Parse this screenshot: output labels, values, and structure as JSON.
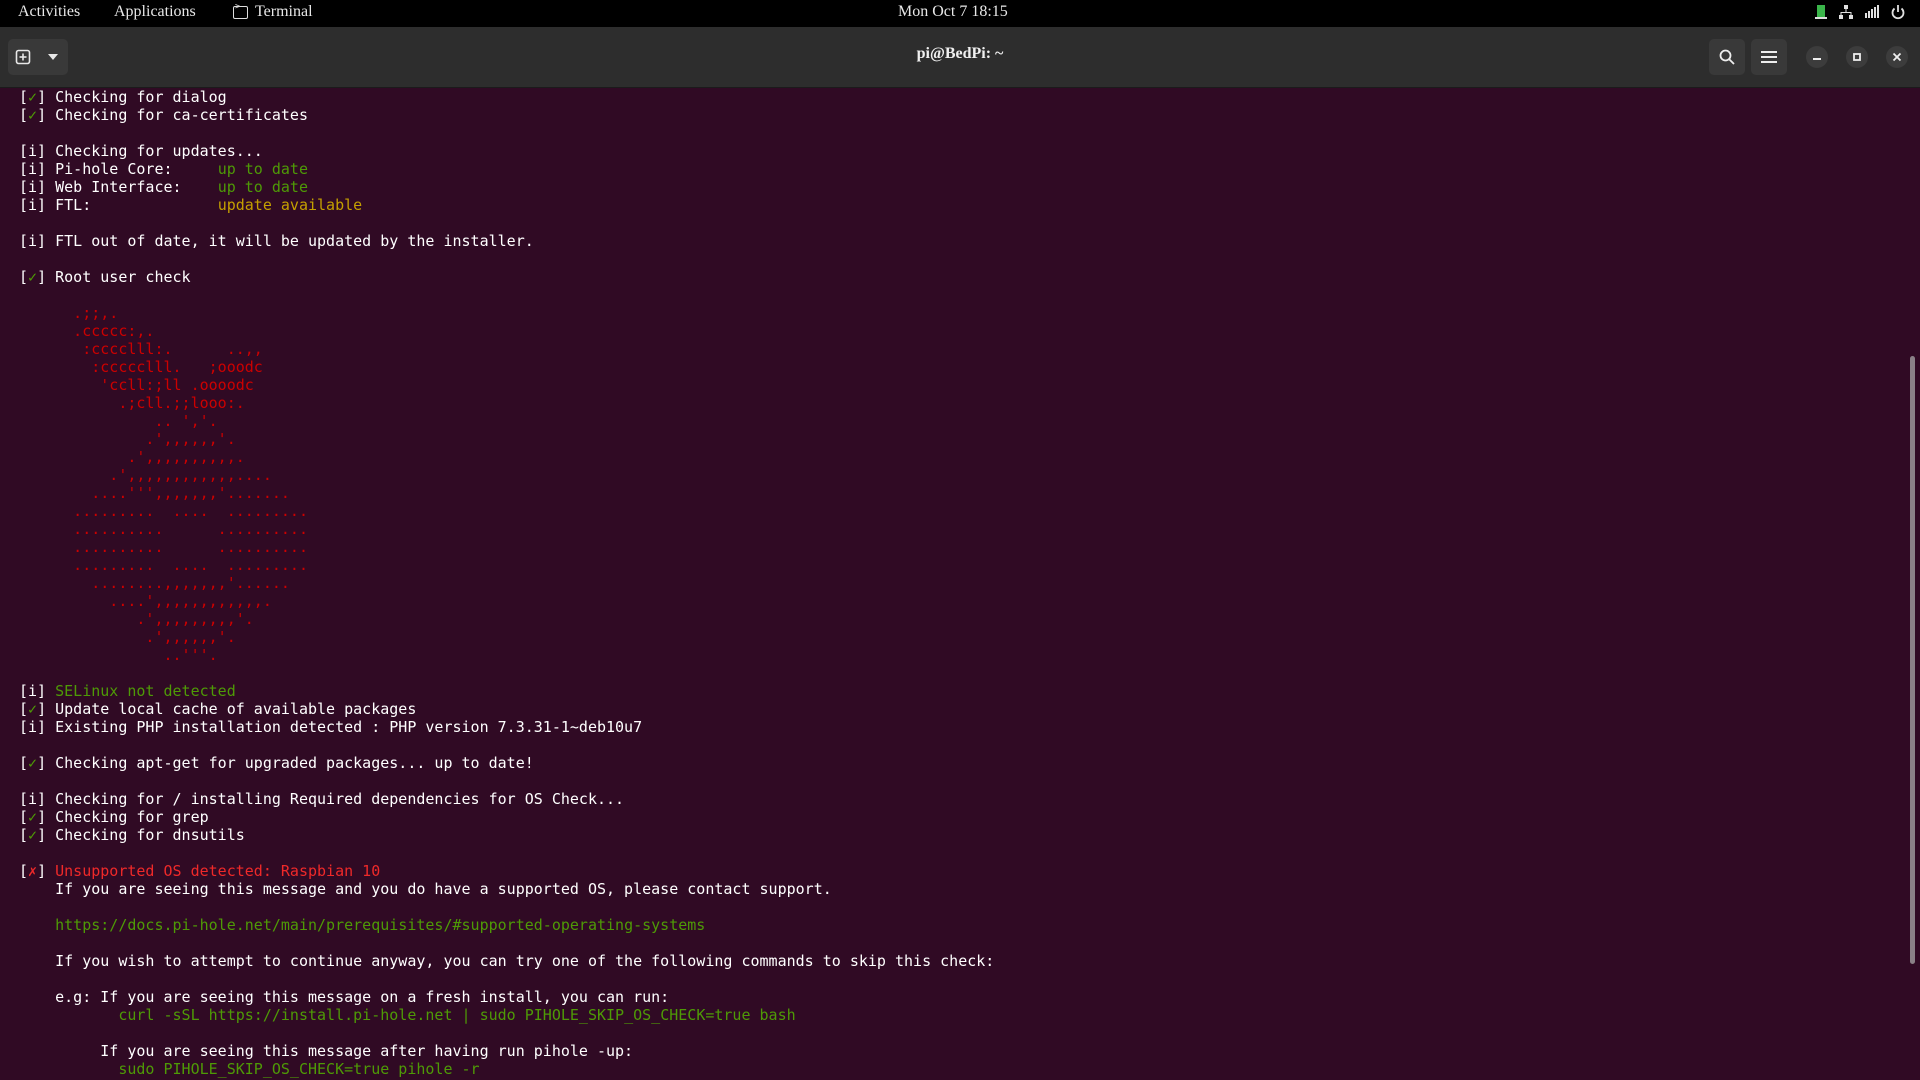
{
  "topbar": {
    "activities": "Activities",
    "applications": "Applications",
    "app_name": "Terminal",
    "clock": "Mon  Oct  7  18:15",
    "tray_icons": [
      "monitor-icon",
      "network-icon",
      "volume-icon",
      "power-icon"
    ]
  },
  "window": {
    "title": "pi@BedPi: ~",
    "buttons": [
      "new-tab",
      "tab-menu",
      "search",
      "hamburger-menu",
      "minimize",
      "maximize",
      "close"
    ]
  },
  "terminal": {
    "lines": [
      [
        {
          "t": "[",
          "c": ""
        },
        {
          "t": "✓",
          "c": "ok"
        },
        {
          "t": "] Checking for dialog",
          "c": ""
        }
      ],
      [
        {
          "t": "[",
          "c": ""
        },
        {
          "t": "✓",
          "c": "ok"
        },
        {
          "t": "] Checking for ca-certificates",
          "c": ""
        }
      ],
      [],
      [
        {
          "t": "[i] Checking for updates...",
          "c": ""
        }
      ],
      [
        {
          "t": "[i] Pi-hole Core:     ",
          "c": ""
        },
        {
          "t": "up to date",
          "c": "green"
        }
      ],
      [
        {
          "t": "[i] Web Interface:    ",
          "c": ""
        },
        {
          "t": "up to date",
          "c": "green"
        }
      ],
      [
        {
          "t": "[i] FTL:              ",
          "c": ""
        },
        {
          "t": "update available",
          "c": "yellow"
        }
      ],
      [],
      [
        {
          "t": "[i] FTL out of date, it will be updated by the installer.",
          "c": ""
        }
      ],
      [],
      [
        {
          "t": "[",
          "c": ""
        },
        {
          "t": "✓",
          "c": "ok"
        },
        {
          "t": "] Root user check",
          "c": ""
        }
      ],
      [],
      [
        {
          "t": "      .;;,.",
          "c": "art"
        }
      ],
      [
        {
          "t": "      .ccccc:,.",
          "c": "art"
        }
      ],
      [
        {
          "t": "       :cccclll:.      ..,,",
          "c": "art"
        }
      ],
      [
        {
          "t": "        :ccccclll.   ;ooodc",
          "c": "art"
        }
      ],
      [
        {
          "t": "         'ccll:;ll .oooodc",
          "c": "art"
        }
      ],
      [
        {
          "t": "           .;cll.;;looo:.",
          "c": "art"
        }
      ],
      [
        {
          "t": "               .. ','.",
          "c": "art"
        }
      ],
      [
        {
          "t": "              .',,,,,,'.",
          "c": "art"
        }
      ],
      [
        {
          "t": "            .',,,,,,,,,,.",
          "c": "art"
        }
      ],
      [
        {
          "t": "          .',,,,,,,,,,,,....",
          "c": "art"
        }
      ],
      [
        {
          "t": "        ....''',,,,,,,'.......",
          "c": "art"
        }
      ],
      [
        {
          "t": "      .........  ....  .........",
          "c": "art"
        }
      ],
      [
        {
          "t": "      ..........      ..........",
          "c": "art"
        }
      ],
      [
        {
          "t": "      ..........      ..........",
          "c": "art"
        }
      ],
      [
        {
          "t": "      .........  ....  .........",
          "c": "art"
        }
      ],
      [
        {
          "t": "        ........,,,,,,,'......",
          "c": "art"
        }
      ],
      [
        {
          "t": "          ....',,,,,,,,,,,,.",
          "c": "art"
        }
      ],
      [
        {
          "t": "             .',,,,,,,,,'.",
          "c": "art"
        }
      ],
      [
        {
          "t": "              .',,,,,,'.",
          "c": "art"
        }
      ],
      [
        {
          "t": "                ..'''.",
          "c": "art"
        }
      ],
      [],
      [
        {
          "t": "[i] ",
          "c": ""
        },
        {
          "t": "SELinux not detected",
          "c": "green"
        }
      ],
      [
        {
          "t": "[",
          "c": ""
        },
        {
          "t": "✓",
          "c": "ok"
        },
        {
          "t": "] Update local cache of available packages",
          "c": ""
        }
      ],
      [
        {
          "t": "[i] Existing PHP installation detected : PHP version 7.3.31-1~deb10u7",
          "c": ""
        }
      ],
      [],
      [
        {
          "t": "[",
          "c": ""
        },
        {
          "t": "✓",
          "c": "ok"
        },
        {
          "t": "] Checking apt-get for upgraded packages... up to date!",
          "c": ""
        }
      ],
      [],
      [
        {
          "t": "[i] Checking for / installing Required dependencies for OS Check...",
          "c": ""
        }
      ],
      [
        {
          "t": "[",
          "c": ""
        },
        {
          "t": "✓",
          "c": "ok"
        },
        {
          "t": "] Checking for grep",
          "c": ""
        }
      ],
      [
        {
          "t": "[",
          "c": ""
        },
        {
          "t": "✓",
          "c": "ok"
        },
        {
          "t": "] Checking for dnsutils",
          "c": ""
        }
      ],
      [],
      [
        {
          "t": "[",
          "c": ""
        },
        {
          "t": "✗",
          "c": "err"
        },
        {
          "t": "] ",
          "c": ""
        },
        {
          "t": "Unsupported OS detected: Raspbian 10",
          "c": "err"
        }
      ],
      [
        {
          "t": "    If you are seeing this message and you do have a supported OS, please contact support.",
          "c": ""
        }
      ],
      [],
      [
        {
          "t": "    ",
          "c": ""
        },
        {
          "t": "https://docs.pi-hole.net/main/prerequisites/#supported-operating-systems",
          "c": "green"
        }
      ],
      [],
      [
        {
          "t": "    If you wish to attempt to continue anyway, you can try one of the following commands to skip this check:",
          "c": ""
        }
      ],
      [],
      [
        {
          "t": "    e.g: If you are seeing this message on a fresh install, you can run:",
          "c": ""
        }
      ],
      [
        {
          "t": "           ",
          "c": ""
        },
        {
          "t": "curl -sSL https://install.pi-hole.net | sudo PIHOLE_SKIP_OS_CHECK=true bash",
          "c": "green"
        }
      ],
      [],
      [
        {
          "t": "         If you are seeing this message after having run pihole -up:",
          "c": ""
        }
      ],
      [
        {
          "t": "           ",
          "c": ""
        },
        {
          "t": "sudo PIHOLE_SKIP_OS_CHECK=true pihole -r",
          "c": "green"
        }
      ]
    ]
  }
}
